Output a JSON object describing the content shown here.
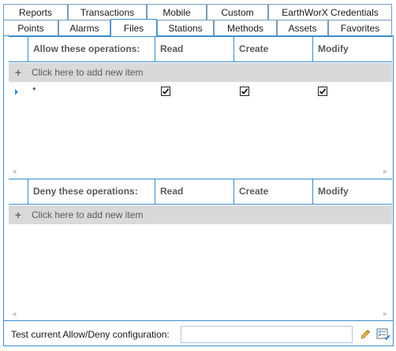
{
  "tabs_row1": [
    {
      "label": "Reports"
    },
    {
      "label": "Transactions"
    },
    {
      "label": "Mobile"
    },
    {
      "label": "Custom"
    },
    {
      "label": "EarthWorX Credentials"
    }
  ],
  "tabs_row2": [
    {
      "label": "Points"
    },
    {
      "label": "Alarms"
    },
    {
      "label": "Files",
      "active": true
    },
    {
      "label": "Stations"
    },
    {
      "label": "Methods"
    },
    {
      "label": "Assets"
    },
    {
      "label": "Favorites"
    }
  ],
  "allow_grid": {
    "headers": [
      "Allow these operations:",
      "Read",
      "Create",
      "Modify"
    ],
    "add_text": "Click here to add new item",
    "rows": [
      {
        "pattern": "*",
        "read": true,
        "create": true,
        "modify": true
      }
    ]
  },
  "deny_grid": {
    "headers": [
      "Deny these operations:",
      "Read",
      "Create",
      "Modify"
    ],
    "add_text": "Click here to add new item",
    "rows": []
  },
  "footer": {
    "label": "Test current Allow/Deny configuration:",
    "input_value": ""
  },
  "colors": {
    "accent": "#3c8cc8",
    "add_row_bg": "#d9d9d9"
  }
}
